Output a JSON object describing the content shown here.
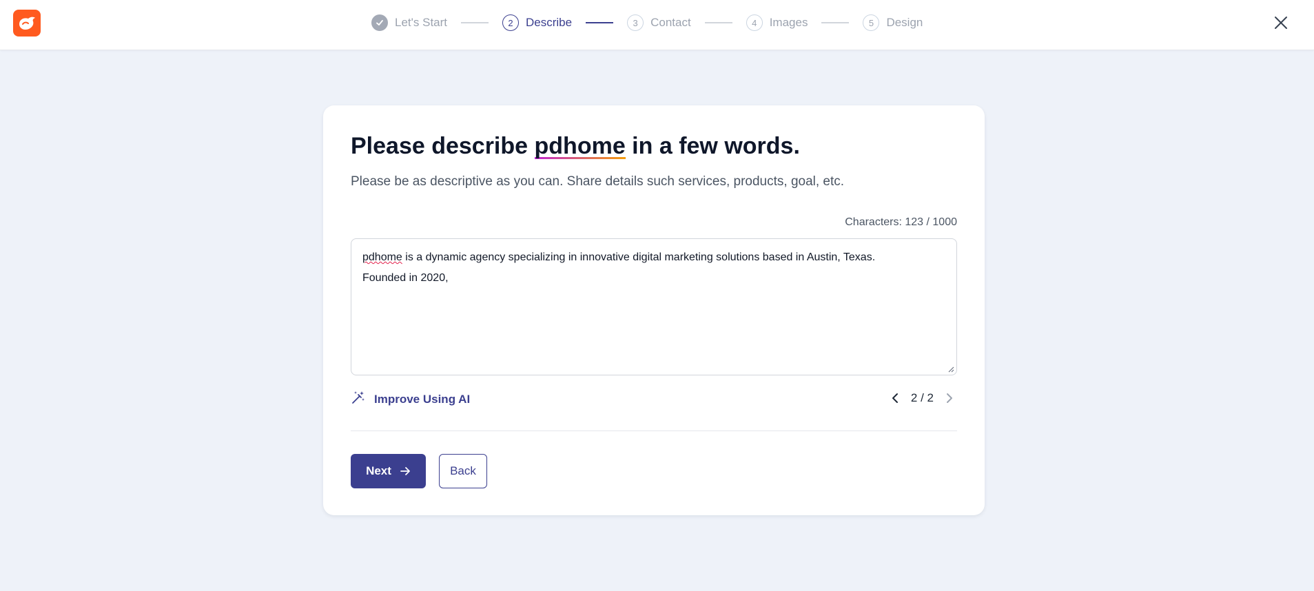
{
  "colors": {
    "accent": "#3b3f8f",
    "brand_logo": "#ff5a1f",
    "background": "#eef2f9",
    "completed_step": "#a3a9b5"
  },
  "header": {
    "logo_icon": "flame-icon",
    "close_icon": "close-icon",
    "steps": [
      {
        "number": "",
        "label": "Let's Start",
        "state": "completed",
        "icon": "check-icon"
      },
      {
        "number": "2",
        "label": "Describe",
        "state": "active"
      },
      {
        "number": "3",
        "label": "Contact",
        "state": "pending"
      },
      {
        "number": "4",
        "label": "Images",
        "state": "pending"
      },
      {
        "number": "5",
        "label": "Design",
        "state": "pending"
      }
    ]
  },
  "form": {
    "title_prefix": "Please describe ",
    "business_name": "pdhome",
    "title_suffix": " in a few words.",
    "subtitle": "Please be as descriptive as you can. Share details such services, products, goal, etc.",
    "char_count": "Characters: 123 / 1000",
    "description_name": "pdhome",
    "description_rest": " is a dynamic agency specializing in innovative digital marketing solutions based in Austin, Texas.",
    "description_line2": "Founded in 2020,",
    "improve_label": "Improve Using AI",
    "improve_icon": "magic-wand-icon",
    "pager_text": "2 / 2",
    "next_label": "Next",
    "back_label": "Back"
  }
}
